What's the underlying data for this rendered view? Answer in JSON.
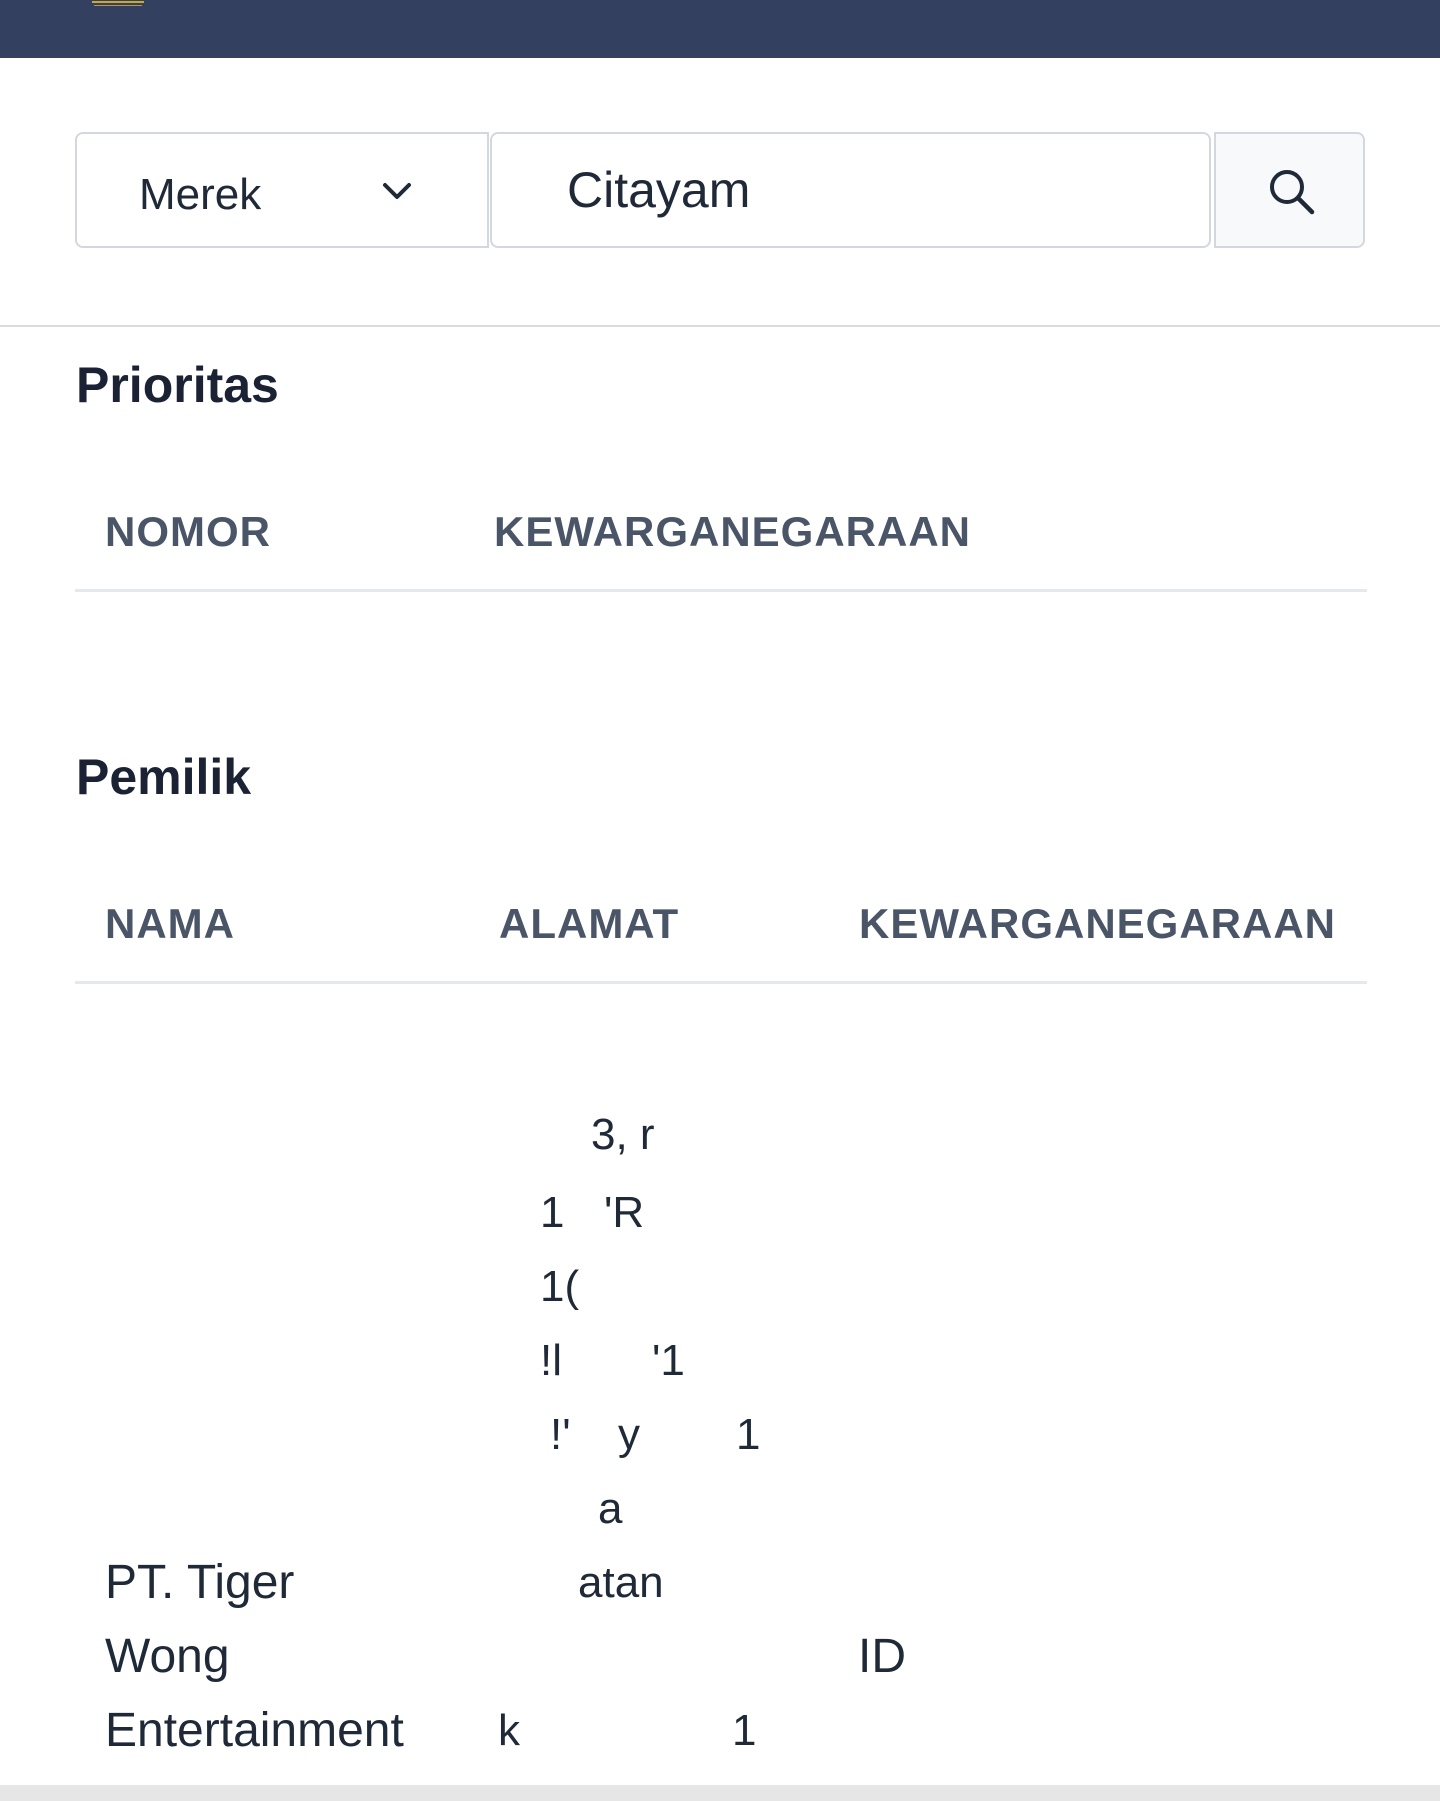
{
  "search": {
    "type_label": "Merek",
    "query": "Citayam"
  },
  "prioritas": {
    "title": "Prioritas",
    "columns": [
      "NOMOR",
      "KEWARGANEGARAAN"
    ]
  },
  "pemilik": {
    "title": "Pemilik",
    "columns": [
      "NAMA",
      "ALAMAT",
      "KEWARGANEGARAAN"
    ],
    "row": {
      "nama_lines": [
        "PT. Tiger",
        "Wong",
        "Entertainment"
      ],
      "alamat_fragments": [
        "3, r",
        "1",
        "'R",
        "1(",
        "!l",
        "'1",
        "!'",
        "y",
        "1",
        "a",
        "atan",
        "k",
        "1"
      ],
      "kewarganegaraan": "ID"
    }
  }
}
